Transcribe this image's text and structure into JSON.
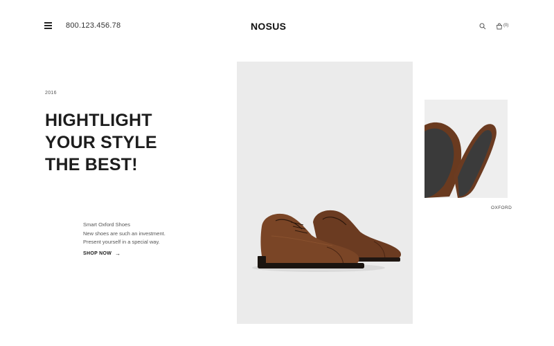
{
  "header": {
    "phone": "800.123.456.78",
    "logo": "NOSUS",
    "cart_count": "(0)",
    "icons": [
      "menu-icon",
      "search-icon",
      "cart-icon"
    ]
  },
  "hero": {
    "year": "2016",
    "headline_lines": [
      "HIGHTLIGHT",
      "YOUR STYLE",
      "THE BEST!"
    ],
    "description_lines": [
      "Smart Oxford Shoes",
      "New shoes are such an investment.",
      "Present yourself in a special way."
    ],
    "cta_label": "SHOP NOW",
    "cta_arrow": "→"
  },
  "side_product": {
    "label": "OXFORD"
  },
  "colors": {
    "text": "#1a1a1a",
    "image_bg": "#ebebeb",
    "leather": "#7a4526"
  }
}
